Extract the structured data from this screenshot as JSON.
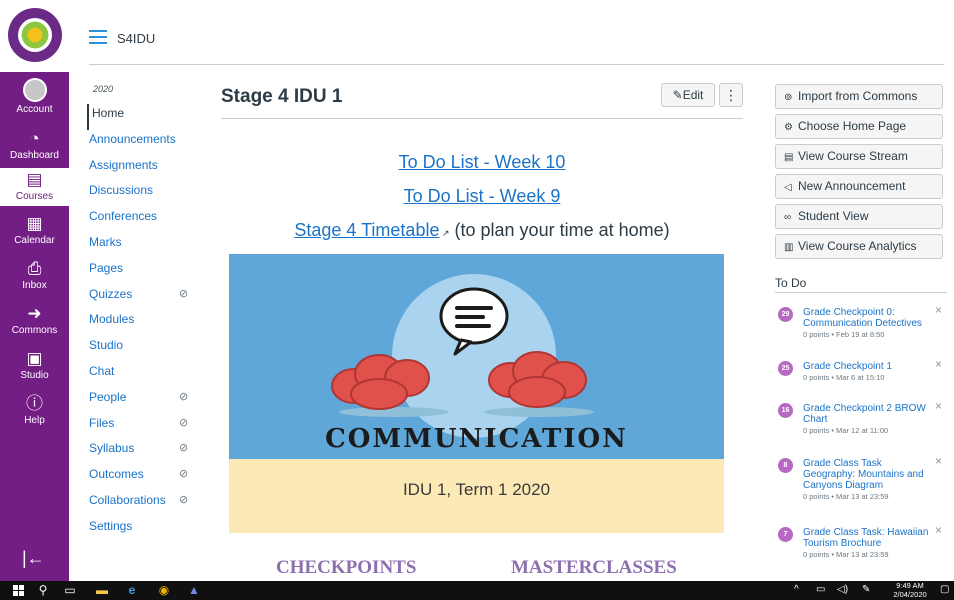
{
  "global_nav": {
    "items": [
      {
        "label": "Account",
        "icon": "account-avatar"
      },
      {
        "label": "Dashboard",
        "icon": "dashboard-gauge-icon"
      },
      {
        "label": "Courses",
        "icon": "courses-book-icon"
      },
      {
        "label": "Calendar",
        "icon": "calendar-icon"
      },
      {
        "label": "Inbox",
        "icon": "inbox-icon"
      },
      {
        "label": "Commons",
        "icon": "commons-icon"
      },
      {
        "label": "Studio",
        "icon": "studio-icon"
      },
      {
        "label": "Help",
        "icon": "help-icon"
      }
    ],
    "active": "Courses",
    "brand_color": "#731e84"
  },
  "header": {
    "breadcrumb": "S4IDU"
  },
  "course_nav": {
    "term": "2020",
    "items": [
      {
        "label": "Home",
        "hidden": false
      },
      {
        "label": "Announcements",
        "hidden": false
      },
      {
        "label": "Assignments",
        "hidden": false
      },
      {
        "label": "Discussions",
        "hidden": false
      },
      {
        "label": "Conferences",
        "hidden": false
      },
      {
        "label": "Marks",
        "hidden": false
      },
      {
        "label": "Pages",
        "hidden": false
      },
      {
        "label": "Quizzes",
        "hidden": true
      },
      {
        "label": "Modules",
        "hidden": false
      },
      {
        "label": "Studio",
        "hidden": false
      },
      {
        "label": "Chat",
        "hidden": false
      },
      {
        "label": "People",
        "hidden": true
      },
      {
        "label": "Files",
        "hidden": true
      },
      {
        "label": "Syllabus",
        "hidden": true
      },
      {
        "label": "Outcomes",
        "hidden": true
      },
      {
        "label": "Collaborations",
        "hidden": true
      },
      {
        "label": "Settings",
        "hidden": false
      }
    ],
    "active": "Home"
  },
  "main": {
    "title": "Stage 4 IDU 1",
    "edit_label": "Edit",
    "links": {
      "week10": "To Do List - Week 10",
      "week9": "To Do List - Week 9",
      "timetable": "Stage 4 Timetable",
      "timetable_suffix": " (to plan your time at home)"
    },
    "banner": {
      "heading": "COMMUNICATION",
      "subheading": "IDU 1, Term 1 2020"
    },
    "sections": {
      "checkpoints": "CHECKPOINTS",
      "masterclasses": "MASTERCLASSES"
    }
  },
  "sidebar": {
    "buttons": [
      {
        "label": "Import from Commons",
        "icon": "import-icon"
      },
      {
        "label": "Choose Home Page",
        "icon": "gear-icon"
      },
      {
        "label": "View Course Stream",
        "icon": "stream-icon"
      },
      {
        "label": "New Announcement",
        "icon": "megaphone-icon"
      },
      {
        "label": "Student View",
        "icon": "glasses-icon"
      },
      {
        "label": "View Course Analytics",
        "icon": "analytics-icon"
      }
    ],
    "todo_title": "To Do",
    "todos": [
      {
        "badge": "29",
        "title": "Grade Checkpoint 0: Communication Detectives",
        "meta": "0 points • Feb 19 at 8:50"
      },
      {
        "badge": "25",
        "title": "Grade Checkpoint 1",
        "meta": "0 points • Mar 6 at 15:10"
      },
      {
        "badge": "16",
        "title": "Grade Checkpoint 2 BROW Chart",
        "meta": "0 points • Mar 12 at 11:00"
      },
      {
        "badge": "8",
        "title": "Grade Class Task Geography: Mountains and Canyons Diagram",
        "meta": "0 points • Mar 13 at 23:59"
      },
      {
        "badge": "7",
        "title": "Grade Class Task: Hawaiian Tourism Brochure",
        "meta": "0 points • Mar 13 at 23:59"
      }
    ]
  },
  "taskbar": {
    "time": "9:49 AM",
    "date": "2/04/2020"
  }
}
